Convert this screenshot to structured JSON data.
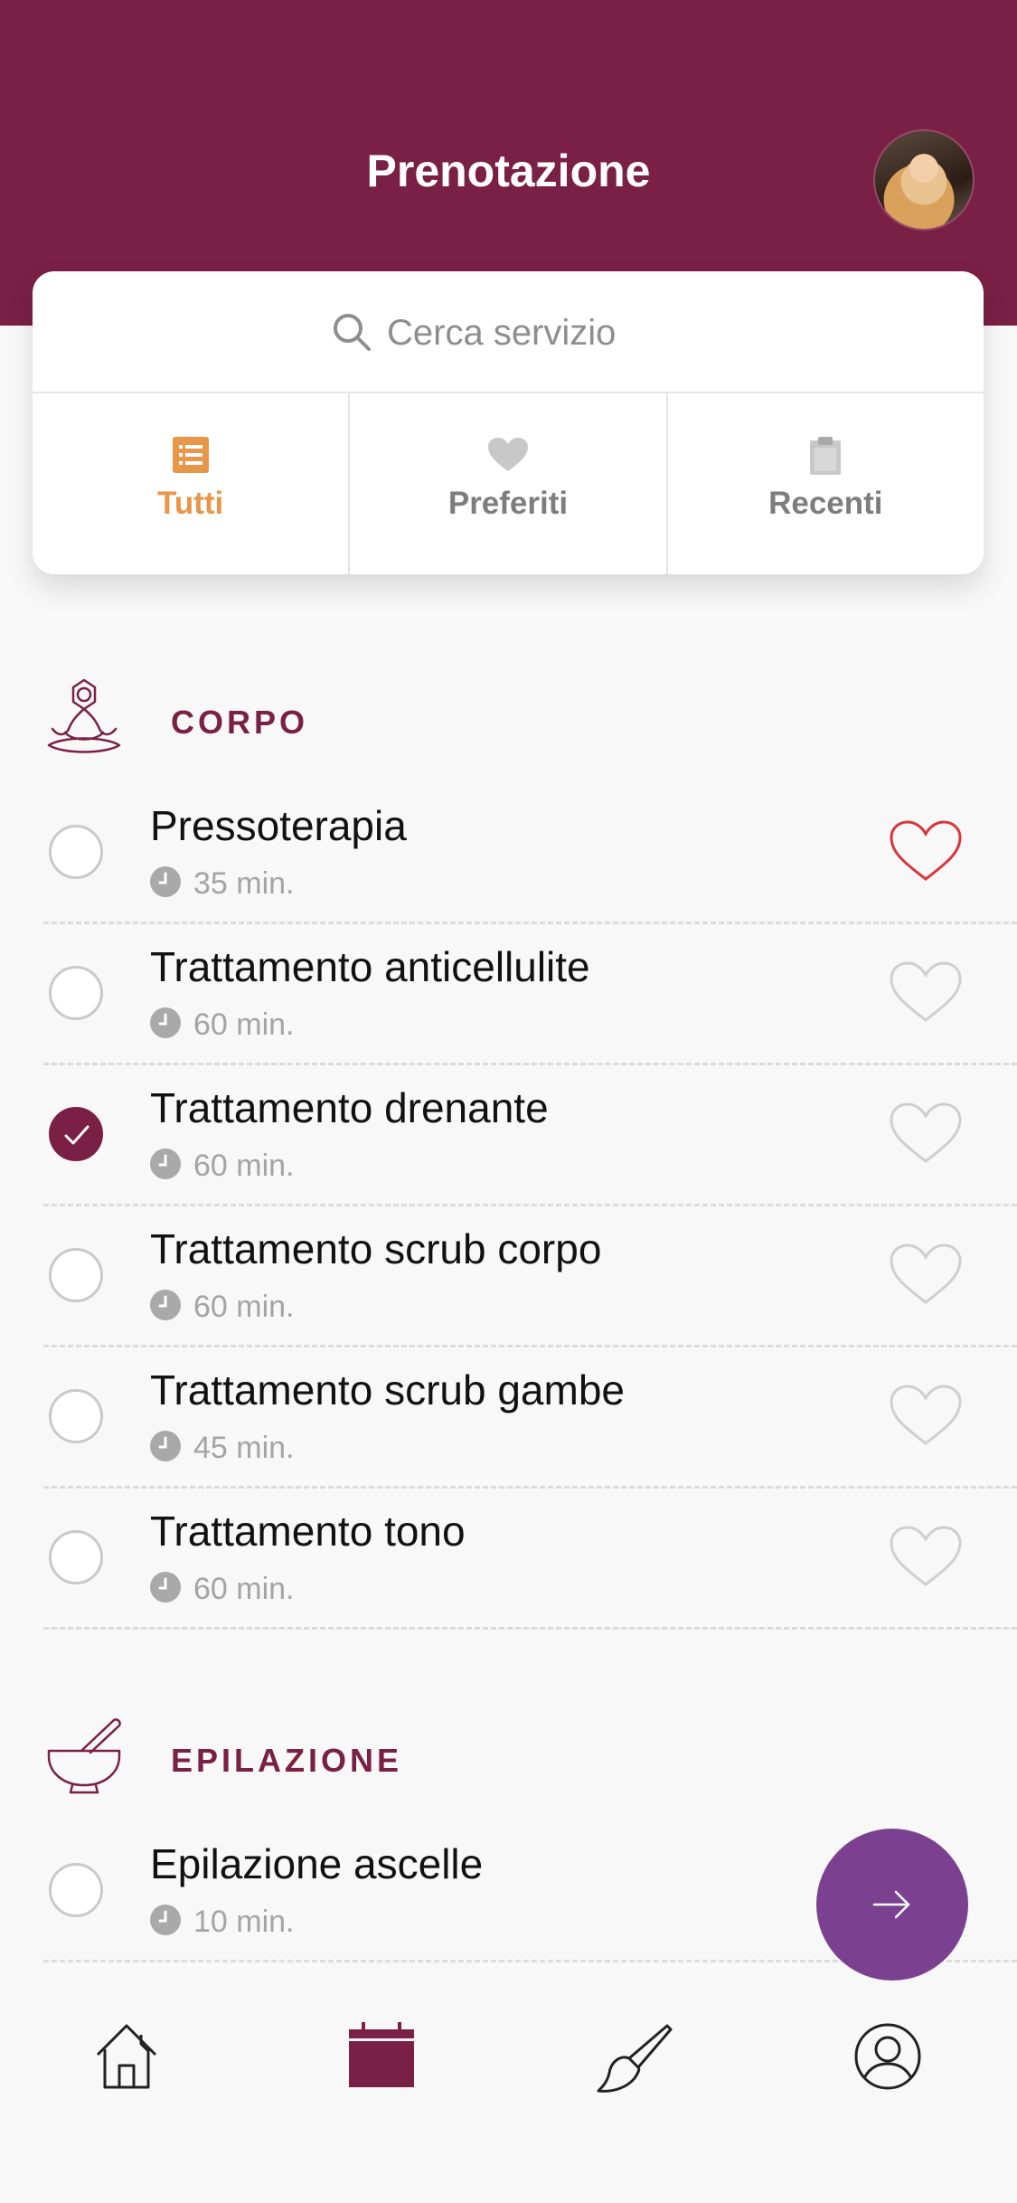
{
  "header": {
    "title": "Prenotazione"
  },
  "search": {
    "placeholder": "Cerca servizio"
  },
  "tabs": [
    {
      "label": "Tutti",
      "icon": "list-icon",
      "active": true
    },
    {
      "label": "Preferiti",
      "icon": "heart-icon",
      "active": false
    },
    {
      "label": "Recenti",
      "icon": "clipboard-icon",
      "active": false
    }
  ],
  "sections": [
    {
      "title": "CORPO",
      "icon": "meditation-icon",
      "items": [
        {
          "name": "Pressoterapia",
          "duration": "35 min.",
          "selected": false,
          "favorite": true
        },
        {
          "name": "Trattamento anticellulite",
          "duration": "60 min.",
          "selected": false,
          "favorite": false
        },
        {
          "name": "Trattamento drenante",
          "duration": "60 min.",
          "selected": true,
          "favorite": false
        },
        {
          "name": "Trattamento scrub corpo",
          "duration": "60 min.",
          "selected": false,
          "favorite": false
        },
        {
          "name": "Trattamento scrub gambe",
          "duration": "45 min.",
          "selected": false,
          "favorite": false
        },
        {
          "name": "Trattamento tono",
          "duration": "60 min.",
          "selected": false,
          "favorite": false
        }
      ]
    },
    {
      "title": "EPILAZIONE",
      "icon": "mortar-pestle-icon",
      "items": [
        {
          "name": "Epilazione ascelle",
          "duration": "10 min.",
          "selected": false,
          "favorite": false
        }
      ]
    }
  ],
  "bottom_nav": [
    {
      "name": "home-icon",
      "active": false
    },
    {
      "name": "calendar-icon",
      "active": true
    },
    {
      "name": "brush-icon",
      "active": false
    },
    {
      "name": "profile-icon",
      "active": false
    }
  ],
  "colors": {
    "brand": "#7a2044",
    "accent_orange": "#e8964a",
    "fab": "#7b4190",
    "favorite_red": "#d9363e"
  }
}
